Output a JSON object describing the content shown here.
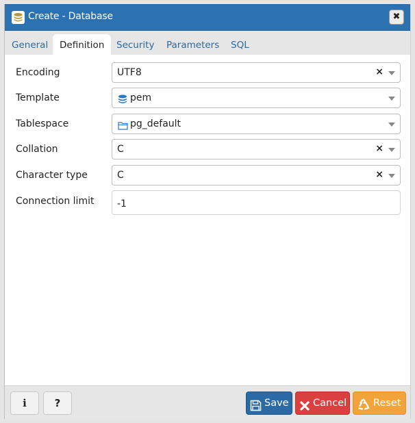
{
  "dialog": {
    "title": "Create - Database",
    "title_icon": "database-icon",
    "close_icon": "close-icon",
    "close_glyph": "✖"
  },
  "tabs": [
    {
      "label": "General",
      "active": false
    },
    {
      "label": "Definition",
      "active": true
    },
    {
      "label": "Security",
      "active": false
    },
    {
      "label": "Parameters",
      "active": false
    },
    {
      "label": "SQL",
      "active": false
    }
  ],
  "form": {
    "encoding": {
      "label": "Encoding",
      "value": "UTF8",
      "clearable": true
    },
    "template": {
      "label": "Template",
      "value": "pem",
      "icon": "database-icon",
      "clearable": false
    },
    "tablespace": {
      "label": "Tablespace",
      "value": "pg_default",
      "icon": "folder-icon",
      "clearable": false
    },
    "collation": {
      "label": "Collation",
      "value": "C",
      "clearable": true
    },
    "character_type": {
      "label": "Character type",
      "value": "C",
      "clearable": true
    },
    "connection_limit": {
      "label": "Connection limit",
      "value": "-1"
    }
  },
  "clear_glyph": "×",
  "footer": {
    "info_glyph": "i",
    "help_glyph": "?",
    "save_label": "Save",
    "cancel_label": "Cancel",
    "reset_label": "Reset"
  },
  "colors": {
    "titlebar": "#2c72b0",
    "tab_link": "#2a6aa3",
    "save": "#2c6aa5",
    "cancel": "#d9403f",
    "reset": "#f2a43a",
    "db_icon_gold": "#b49a3a",
    "db_icon_blue": "#2a78c2"
  }
}
